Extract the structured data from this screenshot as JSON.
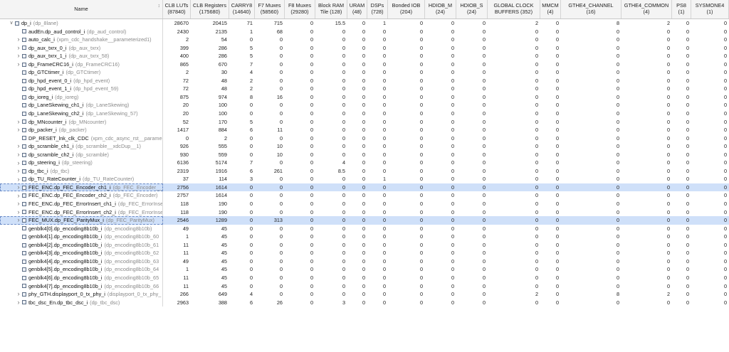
{
  "table": {
    "columns": [
      {
        "label": "Name",
        "w": 229
      },
      {
        "label": "CLB LUTs\n(87840)",
        "w": 39
      },
      {
        "label": "CLB Registers\n(175680)",
        "w": 54
      },
      {
        "label": "CARRY8\n(14640)",
        "w": 36
      },
      {
        "label": "F7 Muxes\n(58560)",
        "w": 42
      },
      {
        "label": "F8 Muxes\n(29280)",
        "w": 43
      },
      {
        "label": "Block RAM\nTile (128)",
        "w": 45
      },
      {
        "label": "URAM\n(48)",
        "w": 28
      },
      {
        "label": "DSPs\n(728)",
        "w": 29
      },
      {
        "label": "Bonded IOB\n(204)",
        "w": 52
      },
      {
        "label": "HDIOB_M\n(24)",
        "w": 44
      },
      {
        "label": "HDIOB_S\n(24)",
        "w": 44
      },
      {
        "label": "GLOBAL CLOCK\nBUFFERS (352)",
        "w": 74
      },
      {
        "label": "MMCM\n(4)",
        "w": 29
      },
      {
        "label": "GTHE4_CHANNEL\n(16)",
        "w": 85
      },
      {
        "label": "GTHE4_COMMON\n(4)",
        "w": 71
      },
      {
        "label": "PS8\n(1)",
        "w": 27
      },
      {
        "label": "SYSMONE4\n(1)",
        "w": 53
      }
    ],
    "rows": [
      {
        "indent": 0,
        "expander": "expanded",
        "name": "dp_i",
        "module": "(dp_8lane)",
        "selected": false,
        "values": [
          "28670",
          "20415",
          "71",
          "715",
          "0",
          "15.5",
          "0",
          "1",
          "0",
          "0",
          "0",
          "2",
          "0",
          "8",
          "2",
          "0",
          "0"
        ]
      },
      {
        "indent": 1,
        "expander": "none",
        "name": "audEn.dp_aud_control_i",
        "module": "(dp_aud_control)",
        "selected": false,
        "values": [
          "2430",
          "2135",
          "1",
          "68",
          "0",
          "0",
          "0",
          "0",
          "0",
          "0",
          "0",
          "0",
          "0",
          "0",
          "0",
          "0",
          "0"
        ]
      },
      {
        "indent": 1,
        "expander": "collapsed",
        "name": "auto_calc_i",
        "module": "(xpm_cdc_handshake__parameterized1)",
        "selected": false,
        "values": [
          "2",
          "54",
          "0",
          "0",
          "0",
          "0",
          "0",
          "0",
          "0",
          "0",
          "0",
          "0",
          "0",
          "0",
          "0",
          "0",
          "0"
        ]
      },
      {
        "indent": 1,
        "expander": "collapsed",
        "name": "dp_aux_txrx_0_i",
        "module": "(dp_aux_txrx)",
        "selected": false,
        "values": [
          "399",
          "286",
          "5",
          "0",
          "0",
          "0",
          "0",
          "0",
          "0",
          "0",
          "0",
          "0",
          "0",
          "0",
          "0",
          "0",
          "0"
        ]
      },
      {
        "indent": 1,
        "expander": "collapsed",
        "name": "dp_aux_txrx_1_i",
        "module": "(dp_aux_txrx_58)",
        "selected": false,
        "values": [
          "400",
          "286",
          "5",
          "0",
          "0",
          "0",
          "0",
          "0",
          "0",
          "0",
          "0",
          "0",
          "0",
          "0",
          "0",
          "0",
          "0"
        ]
      },
      {
        "indent": 1,
        "expander": "collapsed",
        "name": "dp_FrameCRC16_i",
        "module": "(dp_FrameCRC16)",
        "selected": false,
        "values": [
          "865",
          "670",
          "7",
          "0",
          "0",
          "0",
          "0",
          "0",
          "0",
          "0",
          "0",
          "0",
          "0",
          "0",
          "0",
          "0",
          "0"
        ]
      },
      {
        "indent": 1,
        "expander": "none",
        "name": "dp_GTCtimer_i",
        "module": "(dp_GTCtimer)",
        "selected": false,
        "values": [
          "2",
          "30",
          "4",
          "0",
          "0",
          "0",
          "0",
          "0",
          "0",
          "0",
          "0",
          "0",
          "0",
          "0",
          "0",
          "0",
          "0"
        ]
      },
      {
        "indent": 1,
        "expander": "none",
        "name": "dp_hpd_event_0_i",
        "module": "(dp_hpd_event)",
        "selected": false,
        "values": [
          "72",
          "48",
          "2",
          "0",
          "0",
          "0",
          "0",
          "0",
          "0",
          "0",
          "0",
          "0",
          "0",
          "0",
          "0",
          "0",
          "0"
        ]
      },
      {
        "indent": 1,
        "expander": "none",
        "name": "dp_hpd_event_1_i",
        "module": "(dp_hpd_event_59)",
        "selected": false,
        "values": [
          "72",
          "48",
          "2",
          "0",
          "0",
          "0",
          "0",
          "0",
          "0",
          "0",
          "0",
          "0",
          "0",
          "0",
          "0",
          "0",
          "0"
        ]
      },
      {
        "indent": 1,
        "expander": "none",
        "name": "dp_ioreg_i",
        "module": "(dp_ioreg)",
        "selected": false,
        "values": [
          "875",
          "974",
          "8",
          "16",
          "0",
          "0",
          "0",
          "0",
          "0",
          "0",
          "0",
          "0",
          "0",
          "0",
          "0",
          "0",
          "0"
        ]
      },
      {
        "indent": 1,
        "expander": "none",
        "name": "dp_LaneSkewing_ch1_i",
        "module": "(dp_LaneSkewing)",
        "selected": false,
        "values": [
          "20",
          "100",
          "0",
          "0",
          "0",
          "0",
          "0",
          "0",
          "0",
          "0",
          "0",
          "0",
          "0",
          "0",
          "0",
          "0",
          "0"
        ]
      },
      {
        "indent": 1,
        "expander": "none",
        "name": "dp_LaneSkewing_ch2_i",
        "module": "(dp_LaneSkewing_57)",
        "selected": false,
        "values": [
          "20",
          "100",
          "0",
          "0",
          "0",
          "0",
          "0",
          "0",
          "0",
          "0",
          "0",
          "0",
          "0",
          "0",
          "0",
          "0",
          "0"
        ]
      },
      {
        "indent": 1,
        "expander": "collapsed",
        "name": "dp_MNcounter_i",
        "module": "(dp_MNcounter)",
        "selected": false,
        "values": [
          "52",
          "170",
          "5",
          "0",
          "0",
          "0",
          "0",
          "0",
          "0",
          "0",
          "0",
          "0",
          "0",
          "0",
          "0",
          "0",
          "0"
        ]
      },
      {
        "indent": 1,
        "expander": "collapsed",
        "name": "dp_packer_i",
        "module": "(dp_packer)",
        "selected": false,
        "values": [
          "1417",
          "884",
          "6",
          "11",
          "0",
          "0",
          "0",
          "0",
          "0",
          "0",
          "0",
          "0",
          "0",
          "0",
          "0",
          "0",
          "0"
        ]
      },
      {
        "indent": 1,
        "expander": "none",
        "name": "DP_RESET_lnk_clk_CDC",
        "module": "(xpm_cdc_async_rst__parame",
        "selected": false,
        "values": [
          "0",
          "2",
          "0",
          "0",
          "0",
          "0",
          "0",
          "0",
          "0",
          "0",
          "0",
          "0",
          "0",
          "0",
          "0",
          "0",
          "0"
        ]
      },
      {
        "indent": 1,
        "expander": "collapsed",
        "name": "dp_scramble_ch1_i",
        "module": "(dp_scramble__xdcDup__1)",
        "selected": false,
        "values": [
          "926",
          "555",
          "0",
          "10",
          "0",
          "0",
          "0",
          "0",
          "0",
          "0",
          "0",
          "0",
          "0",
          "0",
          "0",
          "0",
          "0"
        ]
      },
      {
        "indent": 1,
        "expander": "collapsed",
        "name": "dp_scramble_ch2_i",
        "module": "(dp_scramble)",
        "selected": false,
        "values": [
          "930",
          "559",
          "0",
          "10",
          "0",
          "0",
          "0",
          "0",
          "0",
          "0",
          "0",
          "0",
          "0",
          "0",
          "0",
          "0",
          "0"
        ]
      },
      {
        "indent": 1,
        "expander": "collapsed",
        "name": "dp_steering_i",
        "module": "(dp_steering)",
        "selected": false,
        "values": [
          "6136",
          "5174",
          "7",
          "0",
          "0",
          "4",
          "0",
          "0",
          "0",
          "0",
          "0",
          "0",
          "0",
          "0",
          "0",
          "0",
          "0"
        ]
      },
      {
        "indent": 1,
        "expander": "collapsed",
        "name": "dp_tbc_i",
        "module": "(dp_tbc)",
        "selected": false,
        "values": [
          "2319",
          "1916",
          "6",
          "261",
          "0",
          "8.5",
          "0",
          "0",
          "0",
          "0",
          "0",
          "0",
          "0",
          "0",
          "0",
          "0",
          "0"
        ]
      },
      {
        "indent": 1,
        "expander": "collapsed",
        "name": "dp_TU_RateCounter_i",
        "module": "(dp_TU_RateCounter)",
        "selected": false,
        "values": [
          "37",
          "114",
          "3",
          "0",
          "0",
          "0",
          "0",
          "1",
          "0",
          "0",
          "0",
          "0",
          "0",
          "0",
          "0",
          "0",
          "0"
        ]
      },
      {
        "indent": 1,
        "expander": "collapsed",
        "name": "FEC_ENC.dp_FEC_Encoder_ch1_i",
        "module": "(dp_FEC_Encoder__",
        "selected": true,
        "values": [
          "2756",
          "1614",
          "0",
          "0",
          "0",
          "0",
          "0",
          "0",
          "0",
          "0",
          "0",
          "0",
          "0",
          "0",
          "0",
          "0",
          "0"
        ]
      },
      {
        "indent": 1,
        "expander": "collapsed",
        "name": "FEC_ENC.dp_FEC_Encoder_ch2_i",
        "module": "(dp_FEC_Encoder)",
        "selected": false,
        "values": [
          "2757",
          "1614",
          "0",
          "0",
          "0",
          "0",
          "0",
          "0",
          "0",
          "0",
          "0",
          "0",
          "0",
          "0",
          "0",
          "0",
          "0"
        ]
      },
      {
        "indent": 1,
        "expander": "collapsed",
        "name": "FEC_ENC.dp_FEC_ErrorInsert_ch1_i",
        "module": "(dp_FEC_ErrorInse",
        "selected": false,
        "values": [
          "118",
          "190",
          "0",
          "0",
          "0",
          "0",
          "0",
          "0",
          "0",
          "0",
          "0",
          "0",
          "0",
          "0",
          "0",
          "0",
          "0"
        ]
      },
      {
        "indent": 1,
        "expander": "collapsed",
        "name": "FEC_ENC.dp_FEC_ErrorInsert_ch2_i",
        "module": "(dp_FEC_ErrorInse",
        "selected": false,
        "values": [
          "118",
          "190",
          "0",
          "0",
          "0",
          "0",
          "0",
          "0",
          "0",
          "0",
          "0",
          "0",
          "0",
          "0",
          "0",
          "0",
          "0"
        ]
      },
      {
        "indent": 1,
        "expander": "collapsed",
        "name": "FEC_MUX.dp_FEC_ParityMux_i",
        "module": "(dp_FEC_ParityMux)",
        "selected": true,
        "values": [
          "2546",
          "1289",
          "0",
          "313",
          "0",
          "0",
          "0",
          "0",
          "0",
          "0",
          "0",
          "0",
          "0",
          "0",
          "0",
          "0",
          "0"
        ]
      },
      {
        "indent": 1,
        "expander": "none",
        "name": "genblk4[0].dp_encoding8b10b_i",
        "module": "(dp_encoding8b10b)",
        "selected": false,
        "values": [
          "49",
          "45",
          "0",
          "0",
          "0",
          "0",
          "0",
          "0",
          "0",
          "0",
          "0",
          "0",
          "0",
          "0",
          "0",
          "0",
          "0"
        ]
      },
      {
        "indent": 1,
        "expander": "none",
        "name": "genblk4[1].dp_encoding8b10b_i",
        "module": "(dp_encoding8b10b_60",
        "selected": false,
        "values": [
          "1",
          "45",
          "0",
          "0",
          "0",
          "0",
          "0",
          "0",
          "0",
          "0",
          "0",
          "0",
          "0",
          "0",
          "0",
          "0",
          "0"
        ]
      },
      {
        "indent": 1,
        "expander": "none",
        "name": "genblk4[2].dp_encoding8b10b_i",
        "module": "(dp_encoding8b10b_61",
        "selected": false,
        "values": [
          "11",
          "45",
          "0",
          "0",
          "0",
          "0",
          "0",
          "0",
          "0",
          "0",
          "0",
          "0",
          "0",
          "0",
          "0",
          "0",
          "0"
        ]
      },
      {
        "indent": 1,
        "expander": "none",
        "name": "genblk4[3].dp_encoding8b10b_i",
        "module": "(dp_encoding8b10b_62",
        "selected": false,
        "values": [
          "11",
          "45",
          "0",
          "0",
          "0",
          "0",
          "0",
          "0",
          "0",
          "0",
          "0",
          "0",
          "0",
          "0",
          "0",
          "0",
          "0"
        ]
      },
      {
        "indent": 1,
        "expander": "none",
        "name": "genblk4[4].dp_encoding8b10b_i",
        "module": "(dp_encoding8b10b_63",
        "selected": false,
        "values": [
          "49",
          "45",
          "0",
          "0",
          "0",
          "0",
          "0",
          "0",
          "0",
          "0",
          "0",
          "0",
          "0",
          "0",
          "0",
          "0",
          "0"
        ]
      },
      {
        "indent": 1,
        "expander": "none",
        "name": "genblk4[5].dp_encoding8b10b_i",
        "module": "(dp_encoding8b10b_64",
        "selected": false,
        "values": [
          "1",
          "45",
          "0",
          "0",
          "0",
          "0",
          "0",
          "0",
          "0",
          "0",
          "0",
          "0",
          "0",
          "0",
          "0",
          "0",
          "0"
        ]
      },
      {
        "indent": 1,
        "expander": "none",
        "name": "genblk4[6].dp_encoding8b10b_i",
        "module": "(dp_encoding8b10b_65",
        "selected": false,
        "values": [
          "11",
          "45",
          "0",
          "0",
          "0",
          "0",
          "0",
          "0",
          "0",
          "0",
          "0",
          "0",
          "0",
          "0",
          "0",
          "0",
          "0"
        ]
      },
      {
        "indent": 1,
        "expander": "none",
        "name": "genblk4[7].dp_encoding8b10b_i",
        "module": "(dp_encoding8b10b_66",
        "selected": false,
        "values": [
          "11",
          "45",
          "0",
          "0",
          "0",
          "0",
          "0",
          "0",
          "0",
          "0",
          "0",
          "0",
          "0",
          "0",
          "0",
          "0",
          "0"
        ]
      },
      {
        "indent": 1,
        "expander": "collapsed",
        "name": "phy_GTH.displayport_0_tx_phy_i",
        "module": "(displayport_0_tx_phy_",
        "selected": false,
        "values": [
          "266",
          "649",
          "4",
          "0",
          "0",
          "0",
          "0",
          "0",
          "0",
          "0",
          "0",
          "2",
          "0",
          "8",
          "2",
          "0",
          "0"
        ]
      },
      {
        "indent": 1,
        "expander": "collapsed",
        "name": "tbc_dsc_En.dp_tbc_dsc_i",
        "module": "(dp_tbc_dsc)",
        "selected": false,
        "values": [
          "2963",
          "388",
          "6",
          "26",
          "0",
          "3",
          "0",
          "0",
          "0",
          "0",
          "0",
          "0",
          "0",
          "0",
          "0",
          "0",
          "0"
        ]
      }
    ]
  },
  "icons": {
    "expanded": "chevron-down-icon",
    "collapsed": "chevron-right-icon",
    "cell": "cell-icon",
    "sort": "sort-icon"
  },
  "colors": {
    "selected_row": "#cfe0f9",
    "module_text": "#8a8a8a",
    "header_bg": "#f4f4f4"
  }
}
